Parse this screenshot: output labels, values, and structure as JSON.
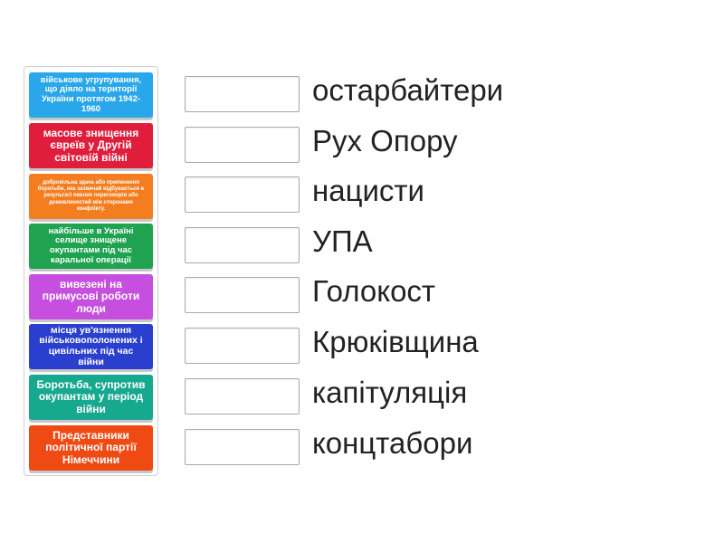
{
  "cards": [
    {
      "text": "військове угрупування, що діяло на території України протягом 1942-1960",
      "color": "#2aa7ea"
    },
    {
      "text": "масове знищення євреїв у Другій світовій війні",
      "color": "#e01e3c"
    },
    {
      "text": "добровільна здача або припинення боротьби, яка зазвичай відбувається в результаті певних переговорів або домовленостей між сторонами конфлікту.",
      "color": "#f47d20"
    },
    {
      "text": "найбільше в Україні селище знищене окупантами під час каральної операції",
      "color": "#1fa350"
    },
    {
      "text": "вивезені на примусові роботи люди",
      "color": "#c64fe0"
    },
    {
      "text": "місця ув'язнення військовополонених і цивільних під час війни",
      "color": "#2b3fcf"
    },
    {
      "text": "Боротьба, супротив окупантам у період війни",
      "color": "#17a890"
    },
    {
      "text": "Представники політичної партії Німеччини",
      "color": "#f04a14"
    }
  ],
  "terms": [
    "остарбайтери",
    "Рух Опору",
    "нацисти",
    "УПА",
    "Голокост",
    "Крюківщина",
    "капітуляція",
    "концтабори"
  ]
}
